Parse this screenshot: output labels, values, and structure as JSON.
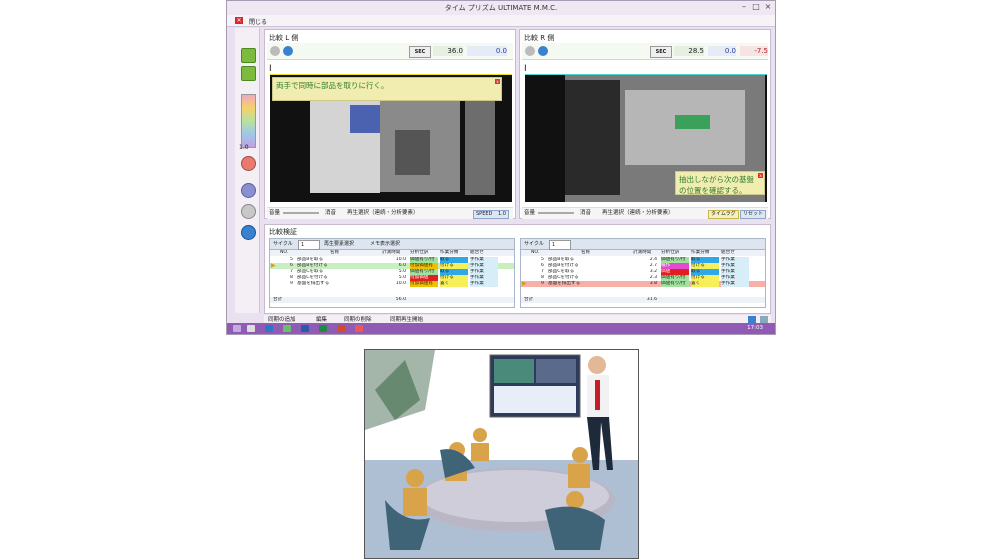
{
  "window": {
    "title": "タイム プリズム ULTIMATE M.M.C.",
    "close_menu": "閉じる"
  },
  "left_panel": {
    "header": "比較 L 側",
    "sec_label": "SEC",
    "time": "36.0",
    "diff": "0.0",
    "caption": "両手で同時に部品を取りに行く。",
    "volume_label": "音量",
    "mute_label": "消音",
    "playback_select": "再生選択（連続・分析要素）",
    "speed_label": "SPEED",
    "speed_value": "1.0"
  },
  "right_panel": {
    "header": "比較 R 側",
    "sec_label": "SEC",
    "time": "28.5",
    "diff": "0.0",
    "delta": "-7.5",
    "caption": "抽出しながら次の基盤の位置を確認する。",
    "volume_label": "音量",
    "mute_label": "消音",
    "playback_select": "再生選択（連続・分析要素）",
    "timelag_label": "タイムラグ",
    "reset_label": "リセット"
  },
  "leftbar": {
    "zoom": "1.0"
  },
  "compare": {
    "header": "比較検証",
    "left": {
      "cycle_label": "サイクル",
      "cycle_value": "1",
      "btn_play_elements": "再生要素選択",
      "btn_memo": "メモ表示選択",
      "columns": [
        "NO.",
        "名称",
        "計測時間",
        "分析仕訳",
        "作業分類",
        "組合せ"
      ],
      "rows": [
        {
          "no": "5",
          "name": "部品Bを取る",
          "time": "10.0",
          "analysis": "価値有り/付",
          "work": "取る",
          "combo": "手作業"
        },
        {
          "no": "6",
          "name": "部品Bを付ける",
          "time": "6.0",
          "analysis": "付加価値有",
          "work": "付ける",
          "combo": "手作業"
        },
        {
          "no": "7",
          "name": "部品Cを取る",
          "time": "5.0",
          "analysis": "価値有り/付",
          "work": "取る",
          "combo": "手作業"
        },
        {
          "no": "8",
          "name": "部品Cを付ける",
          "time": "5.0",
          "analysis": "付加価値",
          "work": "付ける",
          "combo": "手作業"
        },
        {
          "no": "9",
          "name": "基盤を排出する",
          "time": "10.0",
          "analysis": "付加価値有",
          "work": "置く",
          "combo": "手作業"
        }
      ],
      "total_label": "合計",
      "total_value": "56.0"
    },
    "right": {
      "cycle_label": "サイクル",
      "cycle_value": "1",
      "columns": [
        "NO.",
        "名称",
        "計測時間",
        "分析仕訳",
        "作業分類",
        "組合せ"
      ],
      "rows": [
        {
          "no": "5",
          "name": "部品Bを取る",
          "time": "2.4",
          "analysis": "価値有り/付",
          "work": "取る",
          "combo": "手作業"
        },
        {
          "no": "6",
          "name": "部品Bを付ける",
          "time": "2.7",
          "analysis": "検作",
          "work": "付ける",
          "combo": "手作業"
        },
        {
          "no": "7",
          "name": "部品Cを取る",
          "time": "3.2",
          "analysis": "価値",
          "work": "取る",
          "combo": "手作業"
        },
        {
          "no": "8",
          "name": "部品Cを付ける",
          "time": "2.3",
          "analysis": "価値有り/付",
          "work": "付ける",
          "combo": "手作業"
        },
        {
          "no": "9",
          "name": "基盤を排出する",
          "time": "3.8",
          "analysis": "価値有り/付",
          "work": "置く",
          "combo": "手作業"
        }
      ],
      "total_label": "合計",
      "total_value": "31.6"
    }
  },
  "statusbar": {
    "add_step": "同期の追加",
    "edit": "編集",
    "delete_step": "同期の削除",
    "sync_play": "同期再生開始"
  },
  "taskbar": {
    "time": "17:03"
  },
  "colors": {
    "accent": "#8f5bb4",
    "caption_bg": "#f1ecb0",
    "caption_text": "#2f7e2f"
  }
}
